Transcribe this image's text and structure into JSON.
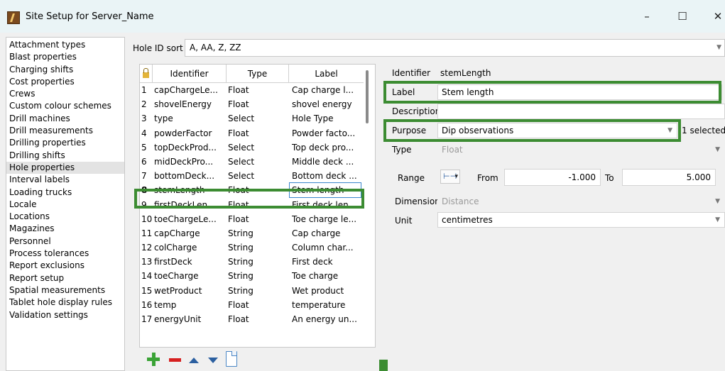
{
  "window": {
    "title": "Site Setup for Server_Name",
    "controls": {
      "minimize": "–",
      "maximize": "☐",
      "close": "✕"
    }
  },
  "sidebar": {
    "items": [
      "Attachment types",
      "Blast properties",
      "Charging shifts",
      "Cost properties",
      "Crews",
      "Custom colour schemes",
      "Drill machines",
      "Drill measurements",
      "Drilling properties",
      "Drilling shifts",
      "Hole properties",
      "Interval labels",
      "Loading trucks",
      "Locale",
      "Locations",
      "Magazines",
      "Personnel",
      "Process tolerances",
      "Report exclusions",
      "Report setup",
      "Spatial measurements",
      "Tablet hole display rules",
      "Validation settings"
    ],
    "selected": "Hole properties"
  },
  "hole_sort": {
    "label": "Hole ID sort",
    "value": "A, AA, Z, ZZ"
  },
  "table": {
    "columns": [
      "Identifier",
      "Type",
      "Label"
    ],
    "rows": [
      {
        "num": "1",
        "identifier": "capChargeLe...",
        "type": "Float",
        "label": "Cap charge l..."
      },
      {
        "num": "2",
        "identifier": "shovelEnergy",
        "type": "Float",
        "label": "shovel energy"
      },
      {
        "num": "3",
        "identifier": "type",
        "type": "Select",
        "label": "Hole Type"
      },
      {
        "num": "4",
        "identifier": "powderFactor",
        "type": "Float",
        "label": "Powder facto..."
      },
      {
        "num": "5",
        "identifier": "topDeckProd...",
        "type": "Select",
        "label": "Top deck pro..."
      },
      {
        "num": "6",
        "identifier": "midDeckPro...",
        "type": "Select",
        "label": "Middle deck ..."
      },
      {
        "num": "7",
        "identifier": "bottomDeck...",
        "type": "Select",
        "label": "Bottom deck ..."
      },
      {
        "num": "8",
        "identifier": "stemLength",
        "type": "Float",
        "label": "Stem length"
      },
      {
        "num": "9",
        "identifier": "firstDeckLen...",
        "type": "Float",
        "label": "First deck len..."
      },
      {
        "num": "10",
        "identifier": "toeChargeLe...",
        "type": "Float",
        "label": "Toe charge le..."
      },
      {
        "num": "11",
        "identifier": "capCharge",
        "type": "String",
        "label": "Cap charge"
      },
      {
        "num": "12",
        "identifier": "colCharge",
        "type": "String",
        "label": "Column char..."
      },
      {
        "num": "13",
        "identifier": "firstDeck",
        "type": "String",
        "label": "First deck"
      },
      {
        "num": "14",
        "identifier": "toeCharge",
        "type": "String",
        "label": "Toe charge"
      },
      {
        "num": "15",
        "identifier": "wetProduct",
        "type": "String",
        "label": "Wet product"
      },
      {
        "num": "16",
        "identifier": "temp",
        "type": "Float",
        "label": "temperature"
      },
      {
        "num": "17",
        "identifier": "energyUnit",
        "type": "Float",
        "label": "An energy un..."
      }
    ],
    "selected_row": 8
  },
  "toolbar": {
    "add": "add-row",
    "remove": "remove-row",
    "up": "move-up",
    "down": "move-down",
    "copy": "copy-row"
  },
  "properties": {
    "identifier": {
      "label": "Identifier",
      "value": "stemLength"
    },
    "label": {
      "label": "Label",
      "value": "Stem length"
    },
    "description": {
      "label": "Description",
      "value": ""
    },
    "purpose": {
      "label": "Purpose",
      "value": "Dip observations",
      "count": "1 selected"
    },
    "type": {
      "label": "Type",
      "value": "Float"
    },
    "range": {
      "label": "Range",
      "from_label": "From",
      "from": "-1.000",
      "to_label": "To",
      "to": "5.000",
      "mode_icon": "⊢⊣"
    },
    "dimension": {
      "label": "Dimension",
      "value": "Distance"
    },
    "unit": {
      "label": "Unit",
      "value": "centimetres"
    }
  },
  "colors": {
    "highlight": "#3c8c32",
    "selection": "#3c86cc"
  }
}
